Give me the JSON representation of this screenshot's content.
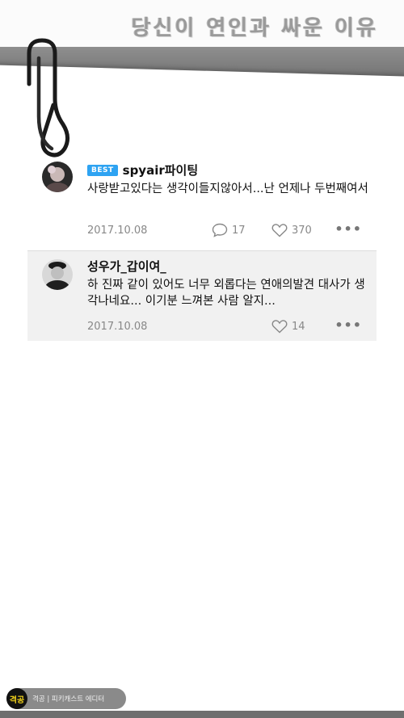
{
  "header": {
    "title": "당신이 연인과 싸운 이유"
  },
  "comments": [
    {
      "badge": "BEST",
      "nickname": "spyair파이팅",
      "text": "사랑받고있다는 생각이들지않아서...난 언제나 두번째여서",
      "date": "2017.10.08",
      "reply_count": "17",
      "like_count": "370",
      "more": "•••",
      "avatar_icon": "avatar-photo"
    },
    {
      "nickname": "성우가_갑이여_",
      "text": "하 진짜 같이 있어도 너무 외롭다는 연애의발견 대사가 생각나네요... 이기분 느껴본 사람 알지...",
      "date": "2017.10.08",
      "like_count": "14",
      "more": "•••",
      "avatar_icon": "avatar-photo"
    }
  ],
  "footer": {
    "logo_text": "격공",
    "label": "격공 | 피키캐스트 에디터"
  },
  "colors": {
    "best_badge": "#2ea3f2",
    "band_gray": "#7a7a7a",
    "footer_logo_text": "#f2d21b"
  }
}
